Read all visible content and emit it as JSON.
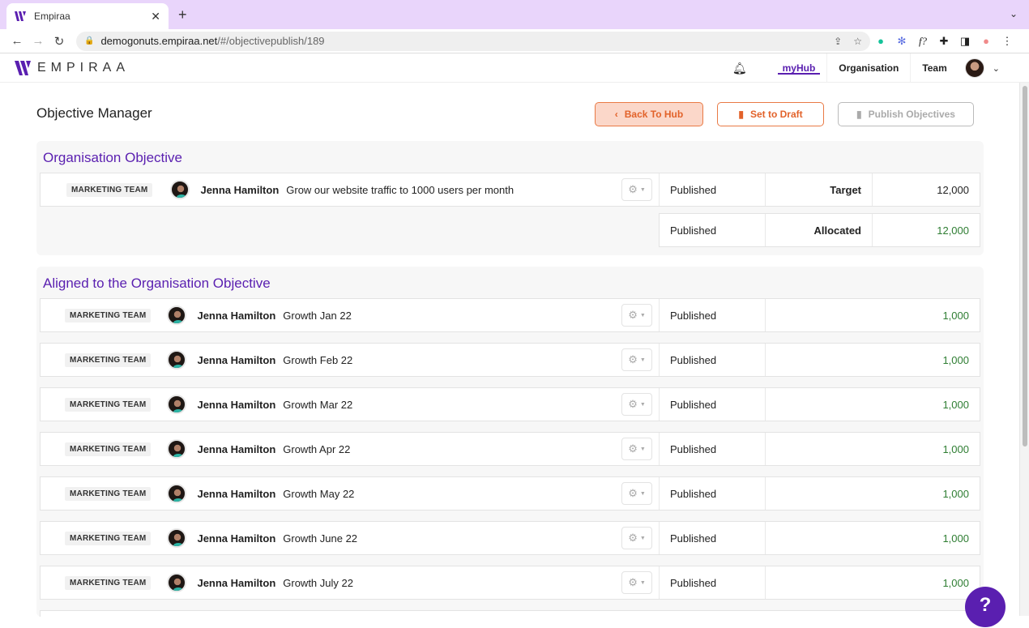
{
  "browser": {
    "tab_title": "Empiraa",
    "url_host": "demogonuts.empiraa.net",
    "url_path": "/#/objectivepublish/189"
  },
  "header": {
    "brand": "EMPIRAA",
    "nav": [
      {
        "label": "myHub",
        "active": true
      },
      {
        "label": "Organisation",
        "active": false
      },
      {
        "label": "Team",
        "active": false
      }
    ]
  },
  "page": {
    "title": "Objective Manager",
    "buttons": {
      "back": "Back To Hub",
      "draft": "Set to Draft",
      "publish": "Publish Objectives"
    }
  },
  "org_section": {
    "title": "Organisation Objective",
    "objective": {
      "team": "MARKETING TEAM",
      "owner": "Jenna Hamilton",
      "name": "Grow our website traffic to 1000 users per month",
      "status": "Published",
      "target_label": "Target",
      "target_value": "12,000"
    },
    "allocated": {
      "status": "Published",
      "label": "Allocated",
      "value": "12,000"
    }
  },
  "aligned_section": {
    "title": "Aligned to the Organisation Objective",
    "rows": [
      {
        "team": "MARKETING TEAM",
        "owner": "Jenna Hamilton",
        "name": "Growth Jan 22",
        "status": "Published",
        "value": "1,000"
      },
      {
        "team": "MARKETING TEAM",
        "owner": "Jenna Hamilton",
        "name": "Growth Feb 22",
        "status": "Published",
        "value": "1,000"
      },
      {
        "team": "MARKETING TEAM",
        "owner": "Jenna Hamilton",
        "name": "Growth Mar 22",
        "status": "Published",
        "value": "1,000"
      },
      {
        "team": "MARKETING TEAM",
        "owner": "Jenna Hamilton",
        "name": "Growth Apr 22",
        "status": "Published",
        "value": "1,000"
      },
      {
        "team": "MARKETING TEAM",
        "owner": "Jenna Hamilton",
        "name": "Growth May 22",
        "status": "Published",
        "value": "1,000"
      },
      {
        "team": "MARKETING TEAM",
        "owner": "Jenna Hamilton",
        "name": "Growth June 22",
        "status": "Published",
        "value": "1,000"
      },
      {
        "team": "MARKETING TEAM",
        "owner": "Jenna Hamilton",
        "name": "Growth July 22",
        "status": "Published",
        "value": "1,000"
      }
    ]
  },
  "help_label": "?",
  "colors": {
    "brand_purple": "#5a1fb0",
    "accent_orange": "#e2622a",
    "value_green": "#2e7d32"
  }
}
